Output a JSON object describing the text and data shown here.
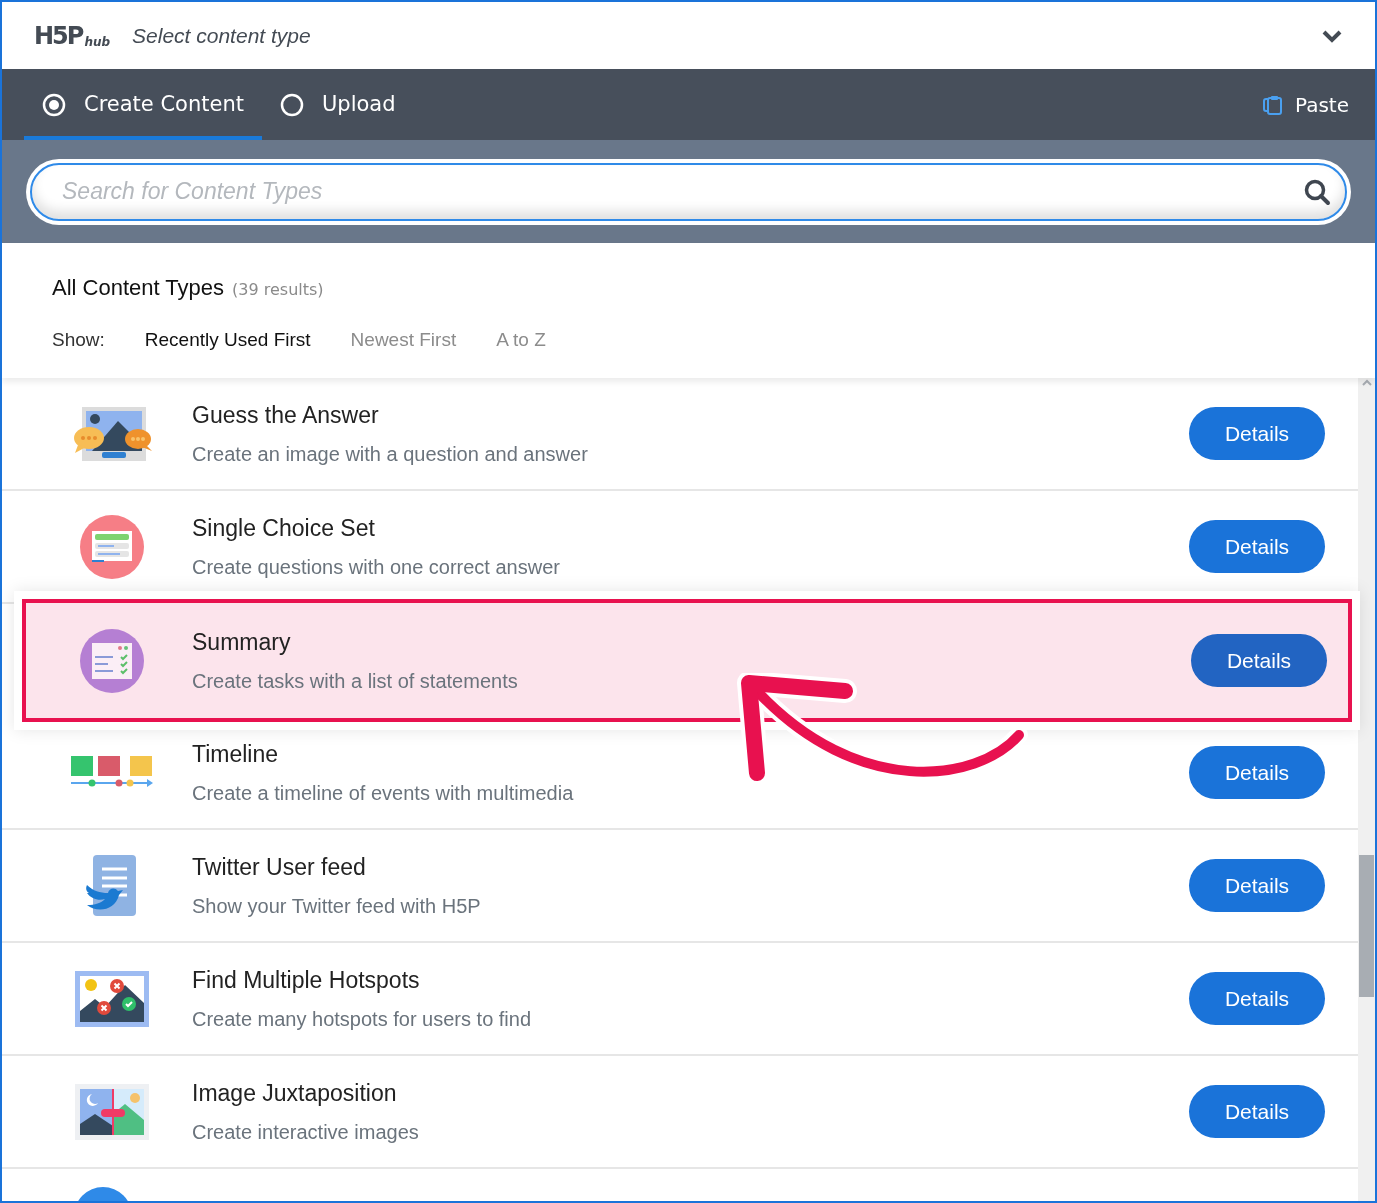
{
  "header": {
    "title": "Select content type",
    "logo_text": "H5P",
    "logo_suffix": "hub"
  },
  "tabs": [
    {
      "label": "Create Content",
      "selected": true
    },
    {
      "label": "Upload",
      "selected": false
    }
  ],
  "paste": {
    "label": "Paste"
  },
  "search": {
    "placeholder": "Search for Content Types"
  },
  "list_header": {
    "title": "All Content Types",
    "count": "(39 results)",
    "show_label": "Show:"
  },
  "sort_options": [
    {
      "label": "Recently Used First",
      "selected": true
    },
    {
      "label": "Newest First",
      "selected": false
    },
    {
      "label": "A to Z",
      "selected": false
    }
  ],
  "content_types": [
    {
      "title": "Guess the Answer",
      "description": "Create an image with a question and answer",
      "button": "Details",
      "highlighted": false
    },
    {
      "title": "Single Choice Set",
      "description": "Create questions with one correct answer",
      "button": "Details",
      "highlighted": false
    },
    {
      "title": "Summary",
      "description": "Create tasks with a list of statements",
      "button": "Details",
      "highlighted": true
    },
    {
      "title": "Timeline",
      "description": "Create a timeline of events with multimedia",
      "button": "Details",
      "highlighted": false
    },
    {
      "title": "Twitter User feed",
      "description": "Show your Twitter feed with H5P",
      "button": "Details",
      "highlighted": false
    },
    {
      "title": "Find Multiple Hotspots",
      "description": "Create many hotspots for users to find",
      "button": "Details",
      "highlighted": false
    },
    {
      "title": "Image Juxtaposition",
      "description": "Create interactive images",
      "button": "Details",
      "highlighted": false
    }
  ]
}
